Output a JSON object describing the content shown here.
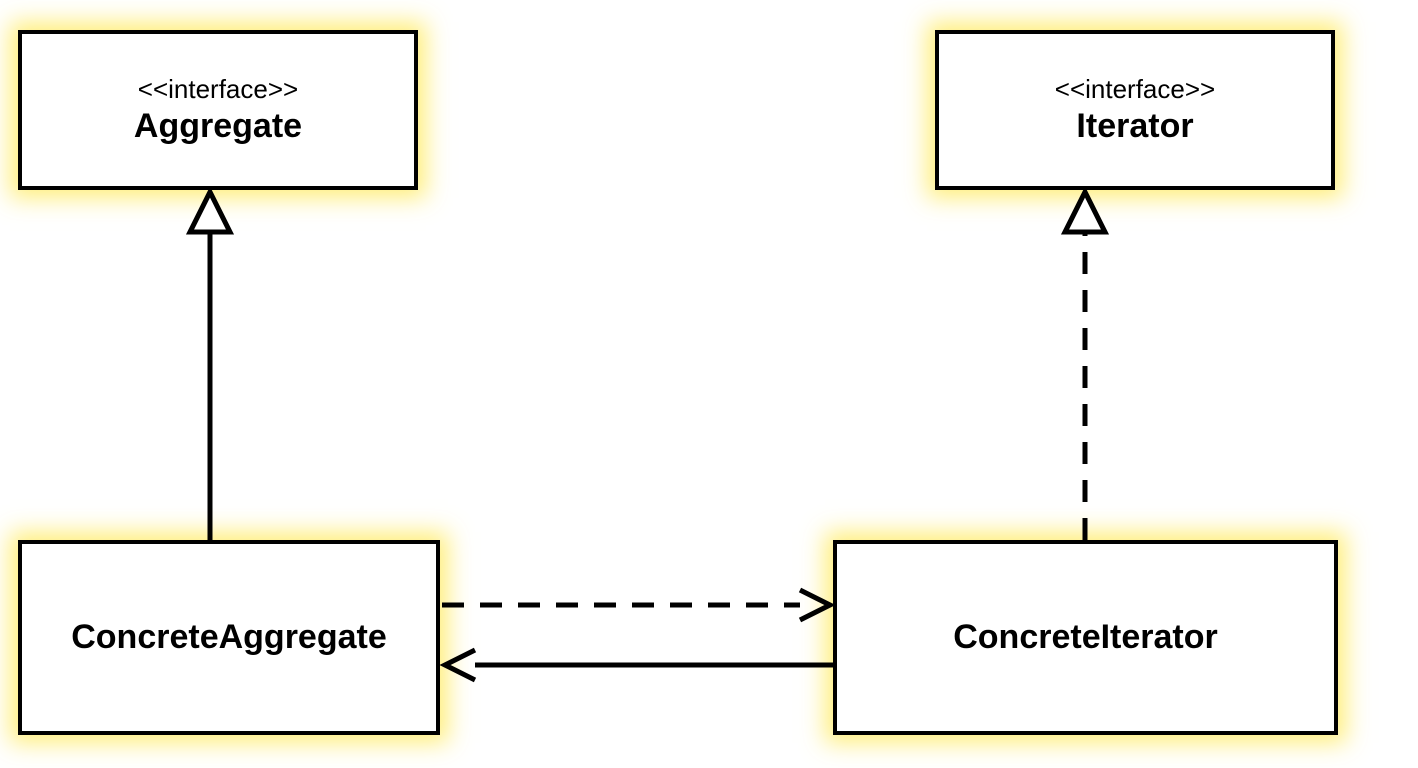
{
  "diagram": {
    "type": "uml-class-diagram",
    "pattern": "Iterator",
    "boxes": {
      "aggregate": {
        "stereotype": "<<interface>>",
        "name": "Aggregate"
      },
      "iterator": {
        "stereotype": "<<interface>>",
        "name": "Iterator"
      },
      "concreteAggregate": {
        "name": "ConcreteAggregate"
      },
      "concreteIterator": {
        "name": "ConcreteIterator"
      }
    },
    "relationships": [
      {
        "from": "ConcreteAggregate",
        "to": "Aggregate",
        "type": "realization-solid-hollow-triangle"
      },
      {
        "from": "ConcreteIterator",
        "to": "Iterator",
        "type": "realization-dashed-hollow-triangle"
      },
      {
        "from": "ConcreteAggregate",
        "to": "ConcreteIterator",
        "type": "dependency-dashed-open-arrow"
      },
      {
        "from": "ConcreteIterator",
        "to": "ConcreteAggregate",
        "type": "association-solid-open-arrow"
      }
    ]
  }
}
